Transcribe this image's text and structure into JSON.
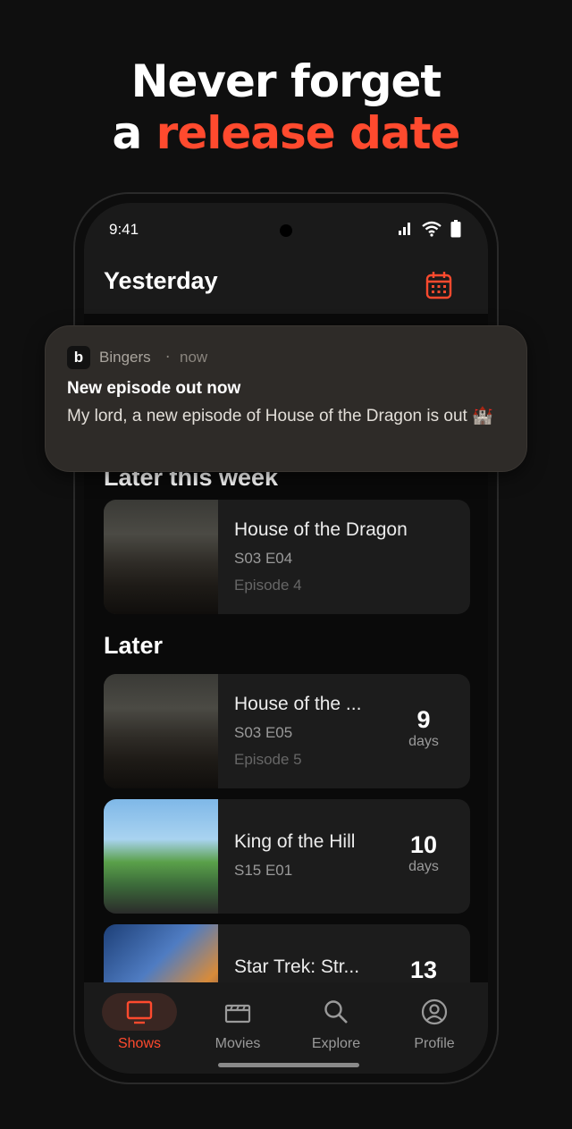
{
  "headline": {
    "line1": "Never forget",
    "line2_plain": "a ",
    "line2_accent": "release date"
  },
  "colors": {
    "accent": "#ff4a2e",
    "background": "#0f0f0f",
    "card": "#1c1c1c"
  },
  "status_bar": {
    "time": "9:41",
    "icons": [
      "signal-icon",
      "wifi-icon",
      "battery-icon"
    ]
  },
  "app_bar": {
    "title": "Yesterday",
    "action_icon": "calendar-icon"
  },
  "notification": {
    "app_icon_letter": "b",
    "app_name": "Bingers",
    "separator": "·",
    "time": "now",
    "title": "New episode out now",
    "body": "My lord, a new episode of House of the Dragon is out 🏰"
  },
  "sections": {
    "later_this_week": {
      "title": "Later this week",
      "items": [
        {
          "name": "House of the Dragon",
          "episode": "S03 E04",
          "subtitle": "Episode 4"
        }
      ]
    },
    "later": {
      "title": "Later",
      "items": [
        {
          "name": "House of the ...",
          "episode": "S03 E05",
          "subtitle": "Episode 5",
          "count": "9",
          "unit": "days"
        },
        {
          "name": "King of the Hill",
          "episode": "S15 E01",
          "count": "10",
          "unit": "days"
        },
        {
          "name": "Star Trek: Str...",
          "count": "13"
        }
      ]
    }
  },
  "bottom_nav": {
    "items": [
      {
        "label": "Shows",
        "icon": "tv-icon",
        "active": true
      },
      {
        "label": "Movies",
        "icon": "clapperboard-icon",
        "active": false
      },
      {
        "label": "Explore",
        "icon": "search-icon",
        "active": false
      },
      {
        "label": "Profile",
        "icon": "profile-icon",
        "active": false
      }
    ]
  }
}
